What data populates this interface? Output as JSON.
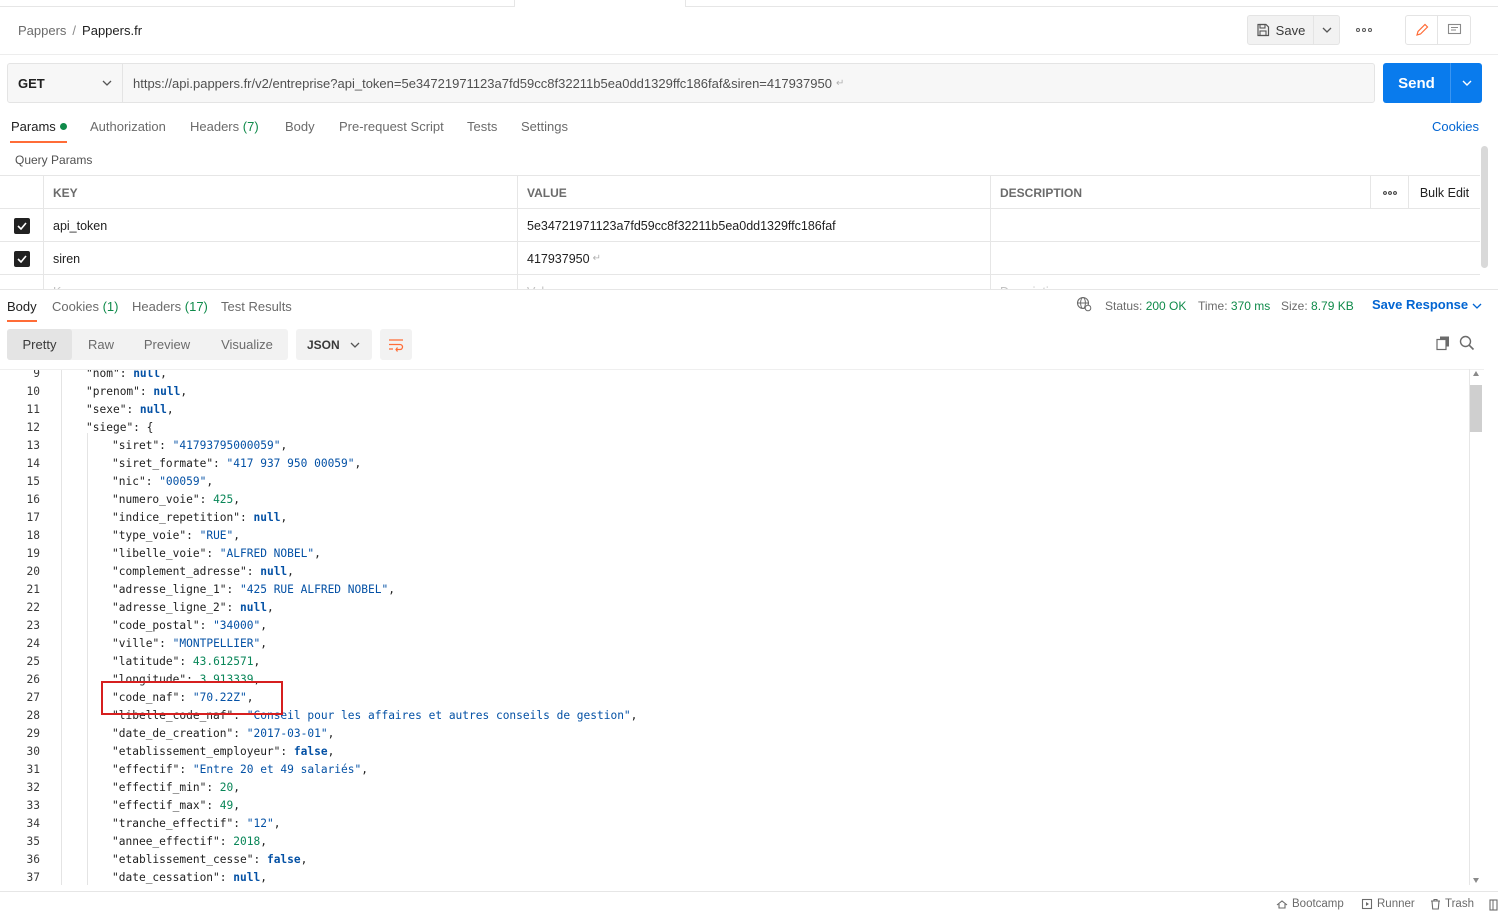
{
  "breadcrumb": {
    "parent": "Pappers",
    "separator": "/",
    "current": "Pappers.fr"
  },
  "toolbar": {
    "save_label": "Save"
  },
  "request": {
    "method": "GET",
    "url": "https://api.pappers.fr/v2/entreprise?api_token=5e34721971123a7fd59cc8f32211b5ea0dd1329ffc186faf&siren=417937950",
    "send_label": "Send"
  },
  "request_tabs": [
    {
      "label": "Params",
      "count": ""
    },
    {
      "label": "Authorization",
      "count": ""
    },
    {
      "label": "Headers",
      "count": "(7)"
    },
    {
      "label": "Body",
      "count": ""
    },
    {
      "label": "Pre-request Script",
      "count": ""
    },
    {
      "label": "Tests",
      "count": ""
    },
    {
      "label": "Settings",
      "count": ""
    }
  ],
  "cookies_link": "Cookies",
  "query_params": {
    "title": "Query Params",
    "headers": {
      "key": "KEY",
      "value": "VALUE",
      "description": "DESCRIPTION",
      "bulk_edit": "Bulk Edit"
    },
    "rows": [
      {
        "key": "api_token",
        "value": "5e34721971123a7fd59cc8f32211b5ea0dd1329ffc186faf",
        "description": ""
      },
      {
        "key": "siren",
        "value": "417937950",
        "description": ""
      }
    ],
    "placeholder": {
      "key": "Key",
      "value": "Value",
      "description": "Description"
    }
  },
  "response_tabs": [
    {
      "label": "Body",
      "count": ""
    },
    {
      "label": "Cookies",
      "count": "(1)"
    },
    {
      "label": "Headers",
      "count": "(17)"
    },
    {
      "label": "Test Results",
      "count": ""
    }
  ],
  "response_meta": {
    "status_label": "Status:",
    "status_value": "200 OK",
    "time_label": "Time:",
    "time_value": "370 ms",
    "size_label": "Size:",
    "size_value": "8.79 KB",
    "save_response": "Save Response"
  },
  "view_modes": [
    "Pretty",
    "Raw",
    "Preview",
    "Visualize"
  ],
  "format": "JSON",
  "code_lines": [
    {
      "n": "9",
      "i": 1,
      "key": "nom",
      "val": "null",
      "t": "b",
      "c": ","
    },
    {
      "n": "10",
      "i": 1,
      "key": "prenom",
      "val": "null",
      "t": "b",
      "c": ","
    },
    {
      "n": "11",
      "i": 1,
      "key": "sexe",
      "val": "null",
      "t": "b",
      "c": ","
    },
    {
      "n": "12",
      "i": 1,
      "key": "siege",
      "val": "{",
      "t": "p",
      "c": ""
    },
    {
      "n": "13",
      "i": 2,
      "key": "siret",
      "val": "\"41793795000059\"",
      "t": "s",
      "c": ","
    },
    {
      "n": "14",
      "i": 2,
      "key": "siret_formate",
      "val": "\"417 937 950 00059\"",
      "t": "s",
      "c": ","
    },
    {
      "n": "15",
      "i": 2,
      "key": "nic",
      "val": "\"00059\"",
      "t": "s",
      "c": ","
    },
    {
      "n": "16",
      "i": 2,
      "key": "numero_voie",
      "val": "425",
      "t": "n",
      "c": ","
    },
    {
      "n": "17",
      "i": 2,
      "key": "indice_repetition",
      "val": "null",
      "t": "b",
      "c": ","
    },
    {
      "n": "18",
      "i": 2,
      "key": "type_voie",
      "val": "\"RUE\"",
      "t": "s",
      "c": ","
    },
    {
      "n": "19",
      "i": 2,
      "key": "libelle_voie",
      "val": "\"ALFRED NOBEL\"",
      "t": "s",
      "c": ","
    },
    {
      "n": "20",
      "i": 2,
      "key": "complement_adresse",
      "val": "null",
      "t": "b",
      "c": ","
    },
    {
      "n": "21",
      "i": 2,
      "key": "adresse_ligne_1",
      "val": "\"425 RUE ALFRED NOBEL\"",
      "t": "s",
      "c": ","
    },
    {
      "n": "22",
      "i": 2,
      "key": "adresse_ligne_2",
      "val": "null",
      "t": "b",
      "c": ","
    },
    {
      "n": "23",
      "i": 2,
      "key": "code_postal",
      "val": "\"34000\"",
      "t": "s",
      "c": ","
    },
    {
      "n": "24",
      "i": 2,
      "key": "ville",
      "val": "\"MONTPELLIER\"",
      "t": "s",
      "c": ","
    },
    {
      "n": "25",
      "i": 2,
      "key": "latitude",
      "val": "43.612571",
      "t": "n",
      "c": ","
    },
    {
      "n": "26",
      "i": 2,
      "key": "longitude",
      "val": "3.913339",
      "t": "n",
      "c": ","
    },
    {
      "n": "27",
      "i": 2,
      "key": "code_naf",
      "val": "\"70.22Z\"",
      "t": "s",
      "c": ","
    },
    {
      "n": "28",
      "i": 2,
      "key": "libelle_code_naf",
      "val": "\"Conseil pour les affaires et autres conseils de gestion\"",
      "t": "s",
      "c": ","
    },
    {
      "n": "29",
      "i": 2,
      "key": "date_de_creation",
      "val": "\"2017-03-01\"",
      "t": "s",
      "c": ","
    },
    {
      "n": "30",
      "i": 2,
      "key": "etablissement_employeur",
      "val": "false",
      "t": "b",
      "c": ","
    },
    {
      "n": "31",
      "i": 2,
      "key": "effectif",
      "val": "\"Entre 20 et 49 salariés\"",
      "t": "s",
      "c": ","
    },
    {
      "n": "32",
      "i": 2,
      "key": "effectif_min",
      "val": "20",
      "t": "n",
      "c": ","
    },
    {
      "n": "33",
      "i": 2,
      "key": "effectif_max",
      "val": "49",
      "t": "n",
      "c": ","
    },
    {
      "n": "34",
      "i": 2,
      "key": "tranche_effectif",
      "val": "\"12\"",
      "t": "s",
      "c": ","
    },
    {
      "n": "35",
      "i": 2,
      "key": "annee_effectif",
      "val": "2018",
      "t": "n",
      "c": ","
    },
    {
      "n": "36",
      "i": 2,
      "key": "etablissement_cesse",
      "val": "false",
      "t": "b",
      "c": ","
    },
    {
      "n": "37",
      "i": 2,
      "key": "date_cessation",
      "val": "null",
      "t": "b",
      "c": ","
    }
  ],
  "status_bar": {
    "bootcamp": "Bootcamp",
    "runner": "Runner",
    "trash": "Trash"
  },
  "colors": {
    "accent": "#097bed",
    "tab_underline": "#ff6c37",
    "success": "#0f8a4a",
    "link": "#0265d2",
    "highlight": "#d61f1f"
  },
  "icons": [
    "save-icon",
    "chevron-down-icon",
    "more-horizontal-icon",
    "pencil-icon",
    "comment-icon",
    "globe-icon",
    "wrap-lines-icon",
    "copy-icon",
    "search-icon",
    "bootcamp-icon",
    "runner-icon",
    "trash-icon",
    "layout-icon"
  ]
}
